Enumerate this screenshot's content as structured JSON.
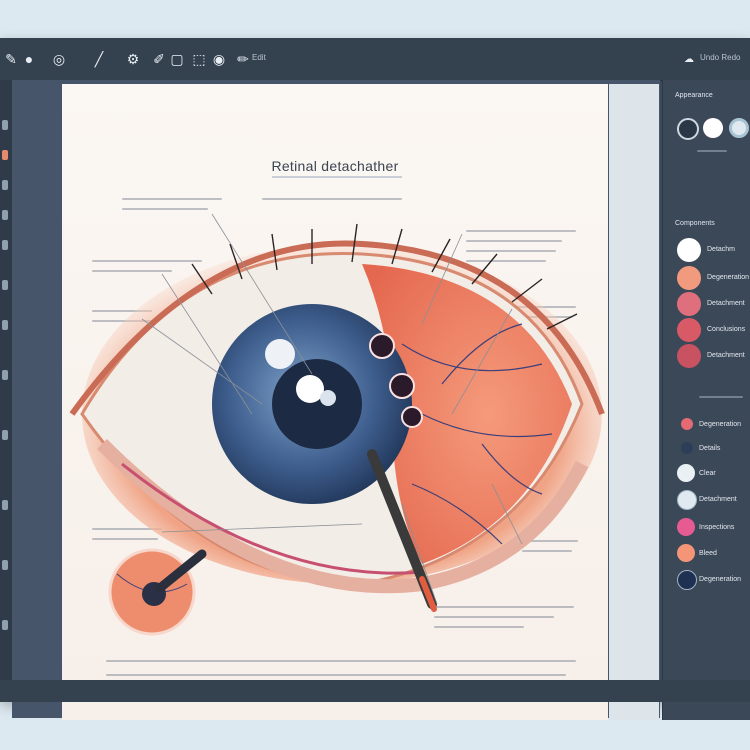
{
  "app": {
    "toolbar_label": "Edit",
    "toolbar_right_label": "Undo Redo"
  },
  "document": {
    "title": "Retinal detachather"
  },
  "panel": {
    "section1_title": "Appearance",
    "section2_title": "Components",
    "swatches": [
      {
        "label": "Detachm",
        "color": "#ffffff"
      },
      {
        "label": "Degeneration",
        "color": "#f29a7e"
      },
      {
        "label": "Detachment",
        "color": "#df6f7d"
      },
      {
        "label": "Conclusions",
        "color": "#d85a66"
      },
      {
        "label": "Detachment",
        "color": "#c95262"
      }
    ],
    "list_items": [
      {
        "label": "Degeneration",
        "color": "#e46b74"
      },
      {
        "label": "Details",
        "color": "#2c3e58"
      },
      {
        "label": "Clear",
        "color": "#e9f1f4"
      },
      {
        "label": "Detachment",
        "color": "#dfe9ef"
      },
      {
        "label": "Inspections",
        "color": "#e75b93"
      },
      {
        "label": "Bleed",
        "color": "#f39576"
      },
      {
        "label": "Degeneration",
        "color": "#1f3152"
      }
    ]
  },
  "colors": {
    "sclera": "#f3ede8",
    "iris": "#3f5f8f",
    "pupil": "#1c2a44",
    "retina": "#f08b6e",
    "vessel": "#3c3f7a"
  }
}
